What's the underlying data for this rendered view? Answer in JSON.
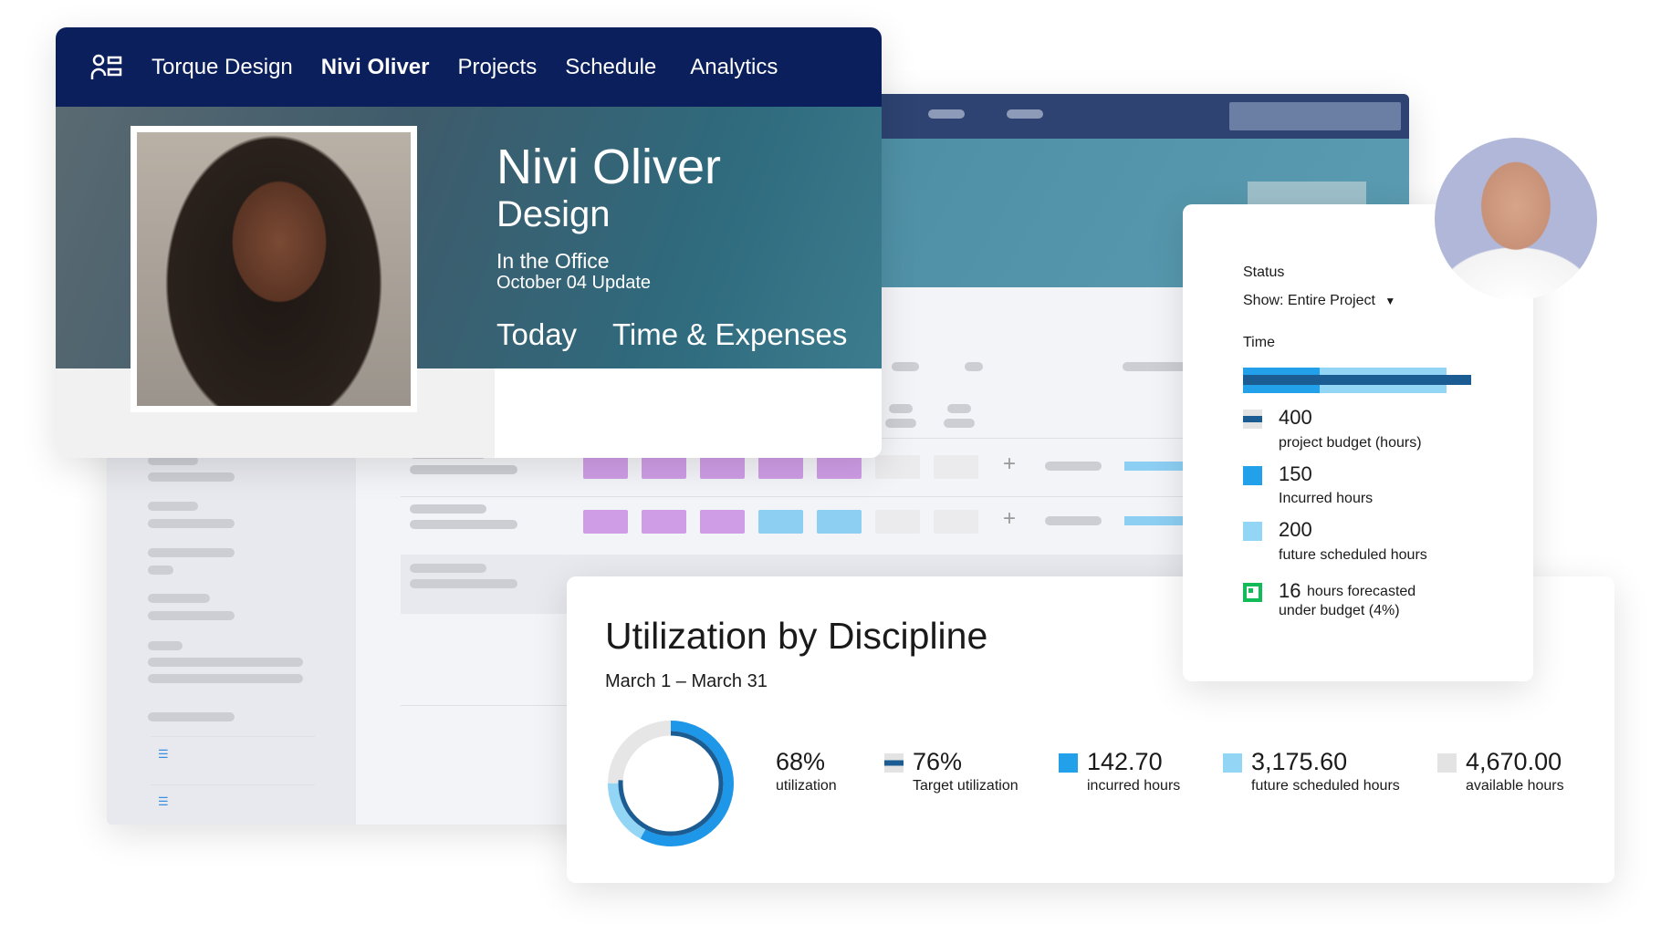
{
  "nav": {
    "items": [
      "Torque Design",
      "Nivi Oliver",
      "Projects",
      "Schedule",
      "Analytics"
    ],
    "active": "Nivi Oliver"
  },
  "profile": {
    "name": "Nivi Oliver",
    "department": "Design",
    "location": "In the Office",
    "update": "October 04 Update",
    "tabs": [
      "Today",
      "Time & Expenses"
    ]
  },
  "status_panel": {
    "title": "Status",
    "filter": "Show: Entire Project",
    "section": "Time",
    "bar": {
      "budget": 400,
      "incurred": 150,
      "future": 200
    },
    "legend": [
      {
        "value": "400",
        "label": "project budget (hours)",
        "color": "#1b5c93"
      },
      {
        "value": "150",
        "label": "Incurred hours",
        "color": "#23a0ea"
      },
      {
        "value": "200",
        "label": "future scheduled hours",
        "color": "#93d5f5"
      }
    ],
    "forecast": {
      "value": "16",
      "label1": "hours forecasted",
      "label2": "under budget (4%)",
      "color": "#10bb58"
    }
  },
  "utilization": {
    "title": "Utilization by Discipline",
    "range": "March 1 – March 31",
    "stats": [
      {
        "value": "68%",
        "label": "utilization"
      },
      {
        "value": "76%",
        "label": "Target utilization",
        "color": "#1b5c93"
      },
      {
        "value": "142.70",
        "label": "incurred hours",
        "color": "#23a0ea"
      },
      {
        "value": "3,175.60",
        "label": "future scheduled hours",
        "color": "#93d5f5"
      },
      {
        "value": "4,670.00",
        "label": "available hours",
        "color": "#e3e3e3"
      }
    ],
    "donut": {
      "incurred_fraction": 0.58,
      "future_fraction": 0.17,
      "target_fraction": 0.76
    }
  },
  "colors": {
    "nav": "#0b1f5c",
    "purple": "#cf9de6",
    "sky": "#8ccff3"
  }
}
